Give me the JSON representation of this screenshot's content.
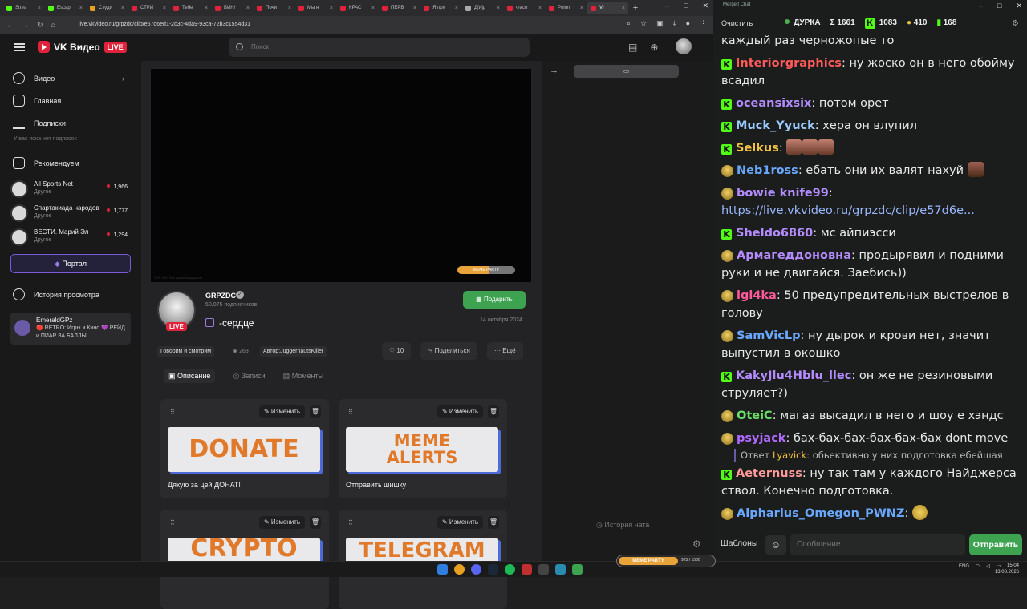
{
  "browser": {
    "tabs": [
      "Strea",
      "Escap",
      "Студи",
      "СТРИ",
      "Тебе",
      "БИН/",
      "Почи",
      "Мы н",
      "КРАС",
      "ПЕРВ",
      "Я про",
      "Д[и]р",
      "Фасо",
      "Polon",
      "VI"
    ],
    "url": "live.vkvideo.ru/grpzdc/clip/e57d6ed1-2c3c-4da9-93ca-72b3c1554d31"
  },
  "vk": {
    "logo_text": "VK Видео",
    "logo_badge": "LIVE",
    "search_placeholder": "Поиск",
    "nav": {
      "video": "Видео",
      "home": "Главная",
      "subs": "Подписки",
      "subs_note": "У вас пока нет подписок",
      "recommended": "Рекомендуем",
      "history": "История просмотра"
    },
    "channels": [
      {
        "name": "All Sports Net",
        "category": "Другое",
        "viewers": "1,966"
      },
      {
        "name": "Спартакиада народов",
        "category": "Другое",
        "viewers": "1,777"
      },
      {
        "name": "ВЕСТИ. Марий Эл",
        "category": "Другое",
        "viewers": "1,294"
      }
    ],
    "portal": "Портал",
    "emerald": {
      "name": "EmeraldGPz",
      "desc": "🔴 RETRO: Игры и Кино 💜 РЕЙД и ПИАР ЗА БАЛЛЫ..."
    },
    "player": {
      "watermark": "©VK 2024 Все права защищены",
      "meme_bar": "MEME PARTY"
    },
    "channel": {
      "name": "GRPZDC",
      "subs": "50,075 подписчиков",
      "live": "LIVE",
      "gift": "Подарить",
      "clip_title": "-сердце",
      "date": "14 октября 2024"
    },
    "tags": {
      "category": "Говорим и смотрим",
      "views": "263",
      "author": "Автор:JuggernautsKiller"
    },
    "actions": {
      "likes": "10",
      "share": "Поделиться",
      "more": "Ещё"
    },
    "tabs": {
      "desc": "Описание",
      "records": "Записи",
      "moments": "Моменты"
    },
    "edit_label": "Изменить",
    "cards": [
      {
        "banner": "DONATE",
        "caption": "Дякую за цей ДОНАТ!"
      },
      {
        "banner": "MEME\nALERTS",
        "caption": "Отправить шишку"
      },
      {
        "banner": "CRYPTO",
        "caption": ""
      },
      {
        "banner": "TELEGRAM",
        "caption": ""
      }
    ],
    "chat_history": "История чата"
  },
  "mergeit": {
    "window_title": "Mergeit Chat",
    "clear": "Очистить",
    "stats": {
      "status": "ДУРКА",
      "sum": "Σ 1661",
      "kick": "1083",
      "vk": "410",
      "other": "168"
    },
    "messages": [
      {
        "platform": "",
        "user": "",
        "color": "#e8e8e8",
        "text": "каждый раз черножопые то"
      },
      {
        "platform": "kick",
        "user": "Interiorgraphics",
        "color": "#ff5a5a",
        "text": "ну жоско он в него обойму всадил"
      },
      {
        "platform": "kick",
        "user": "oceansixsix",
        "color": "#b48cff",
        "text": "потом орет"
      },
      {
        "platform": "kick",
        "user": "Muck_Yyuck",
        "color": "#9acbff",
        "text": "хера он влупил"
      },
      {
        "platform": "kick",
        "user": "Selkus",
        "color": "#f0c040",
        "text": ""
      },
      {
        "platform": "vk",
        "user": "Neb1ross",
        "color": "#6aa8ff",
        "text": "ебать они их валят нахуй"
      },
      {
        "platform": "vk",
        "user": "bowie knife99",
        "color": "#b48cff",
        "text": "https://live.vkvideo.ru/grpzdc/clip/e57d6e..."
      },
      {
        "platform": "kick",
        "user": "Sheldo6860",
        "color": "#b48cff",
        "text": "мс айпиэсси"
      },
      {
        "platform": "vk",
        "user": "Армагеддоновна",
        "color": "#b48cff",
        "text": "продырявил и подними руки и не двигайся. Заебись))"
      },
      {
        "platform": "vk",
        "user": "igi4ka",
        "color": "#ff5a9a",
        "text": "50 предупредительных выстрелов в голову"
      },
      {
        "platform": "vk",
        "user": "SamVicLp",
        "color": "#6aa8ff",
        "text": "ну дырок и крови нет, значит выпустил в окошко"
      },
      {
        "platform": "kick",
        "user": "KakyJlu4Hblu_llec",
        "color": "#b48cff",
        "text": "он же не резиновыми струляет?)"
      },
      {
        "platform": "vk",
        "user": "OteiC",
        "color": "#6adf6a",
        "text": "магаз высадил в него и шоу е хэндс"
      },
      {
        "platform": "vk",
        "user": "psyjack",
        "color": "#b06aff",
        "text": "бах-бах-бах-бах-бах-бах dont move"
      },
      {
        "platform": "kick",
        "user": "Aeternuss",
        "color": "#ff9a9a",
        "text": "ну так там у каждого Найджерса ствол. Конечно подготовка."
      },
      {
        "platform": "vk",
        "user": "Alpharius_Omegon_PWNZ",
        "color": "#6aa8ff",
        "text": ""
      }
    ],
    "reply": {
      "prefix": "Ответ",
      "user": "Lyavick",
      "text": "обьективно у них подготовка ебейшая"
    },
    "templates": "Шаблоны",
    "input_placeholder": "Сообщение...",
    "send": "Отправить"
  },
  "taskbar": {
    "meme_bar": "MEME PARTY",
    "meme_count": "925 / 1500",
    "lang": "ENG",
    "time": "15:04",
    "date": "13.08.2026"
  }
}
